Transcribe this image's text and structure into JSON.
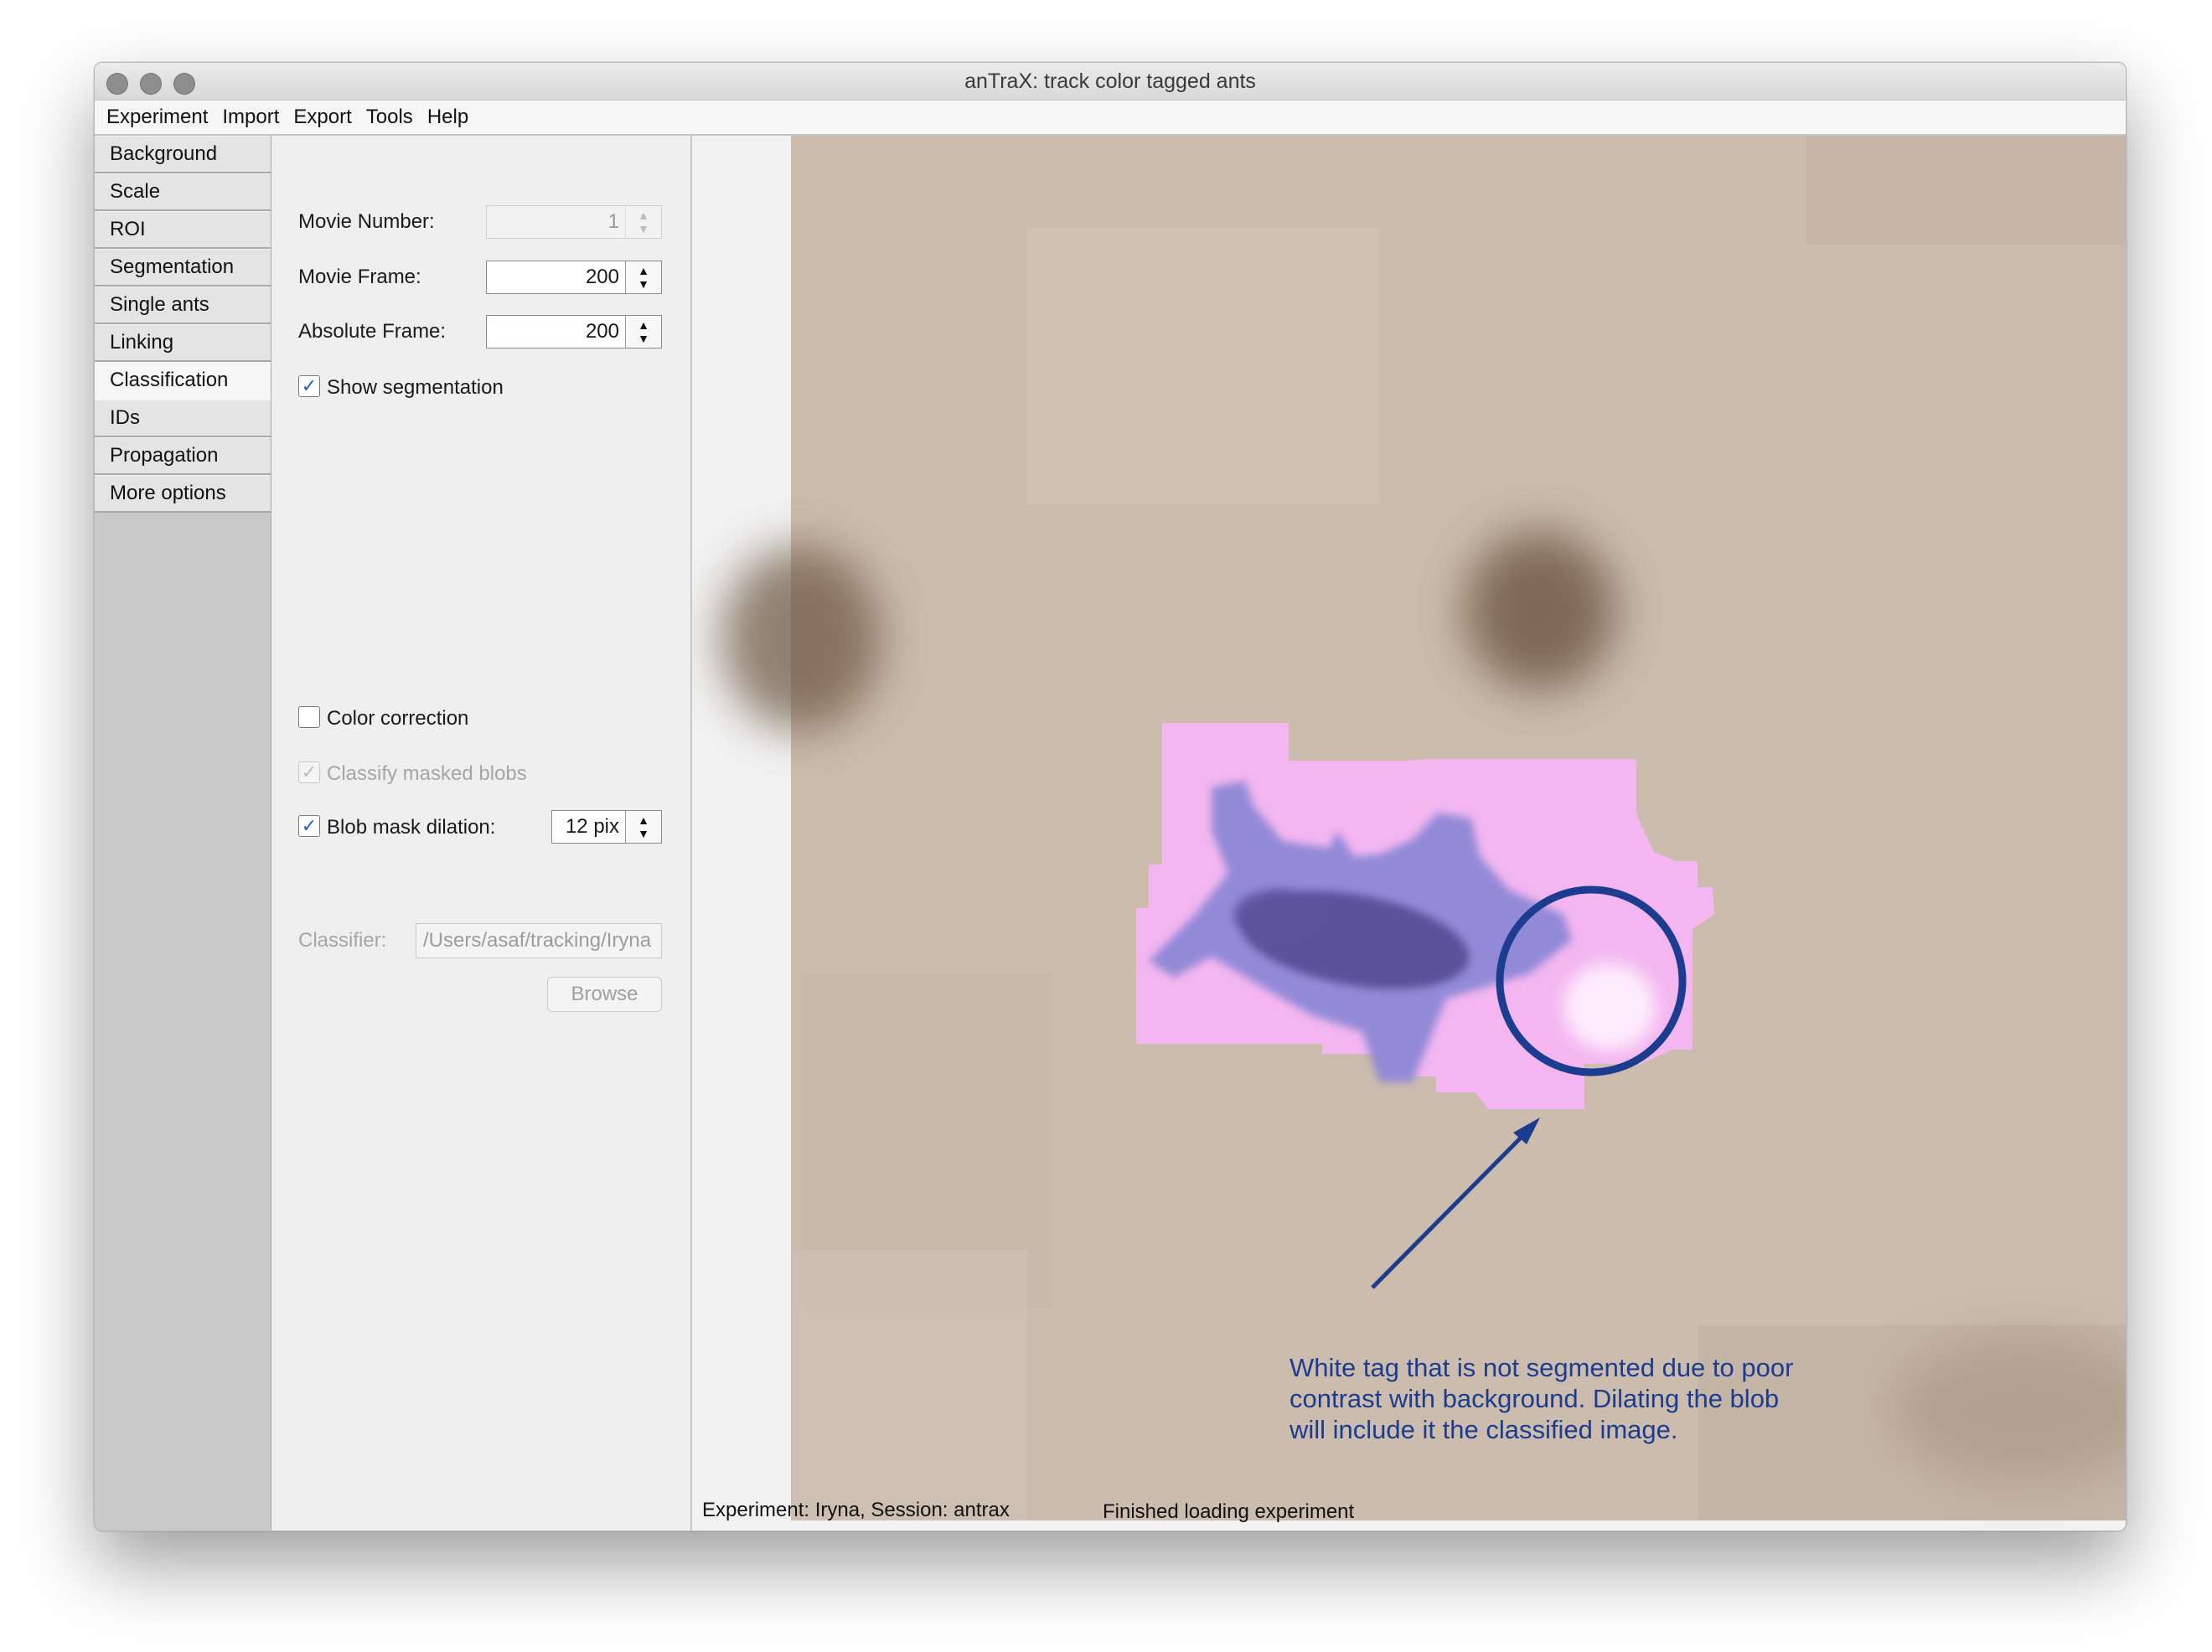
{
  "window": {
    "title": "anTraX: track color tagged ants"
  },
  "menu": [
    "Experiment",
    "Import",
    "Export",
    "Tools",
    "Help"
  ],
  "tabs": [
    {
      "label": "Background",
      "active": false
    },
    {
      "label": "Scale",
      "active": false
    },
    {
      "label": "ROI",
      "active": false
    },
    {
      "label": "Segmentation",
      "active": false
    },
    {
      "label": "Single ants",
      "active": false
    },
    {
      "label": "Linking",
      "active": false
    },
    {
      "label": "Classification",
      "active": true
    },
    {
      "label": "IDs",
      "active": false
    },
    {
      "label": "Propagation",
      "active": false
    },
    {
      "label": "More options",
      "active": false
    }
  ],
  "controls": {
    "movie_number": {
      "label": "Movie Number:",
      "value": "1"
    },
    "movie_frame": {
      "label": "Movie Frame:",
      "value": "200"
    },
    "absolute_frame": {
      "label": "Absolute Frame:",
      "value": "200"
    },
    "show_segmentation": {
      "label": "Show segmentation",
      "checked": true
    },
    "color_correction": {
      "label": "Color correction",
      "checked": false
    },
    "classify_masked": {
      "label": "Classify masked blobs",
      "checked": true,
      "enabled": false
    },
    "blob_mask_dilation": {
      "label": "Blob mask dilation:",
      "checked": true,
      "value": "12 pix"
    },
    "classifier": {
      "label": "Classifier:",
      "value": "/Users/asaf/tracking/Iryna"
    },
    "browse_label": "Browse"
  },
  "status": {
    "experiment": "Experiment: Iryna, Session: antrax",
    "message": "Finished loading experiment"
  },
  "annotation": {
    "line1": "White tag that is not segmented due to poor",
    "line2": "contrast with background. Dilating the blob",
    "line3": "will include it the classified image.",
    "color": "#1c3d8f"
  },
  "colors": {
    "mask_pink": "#f3b6f0",
    "ant_blue": "#6a63b5",
    "background_tan": "#cbbcae"
  }
}
